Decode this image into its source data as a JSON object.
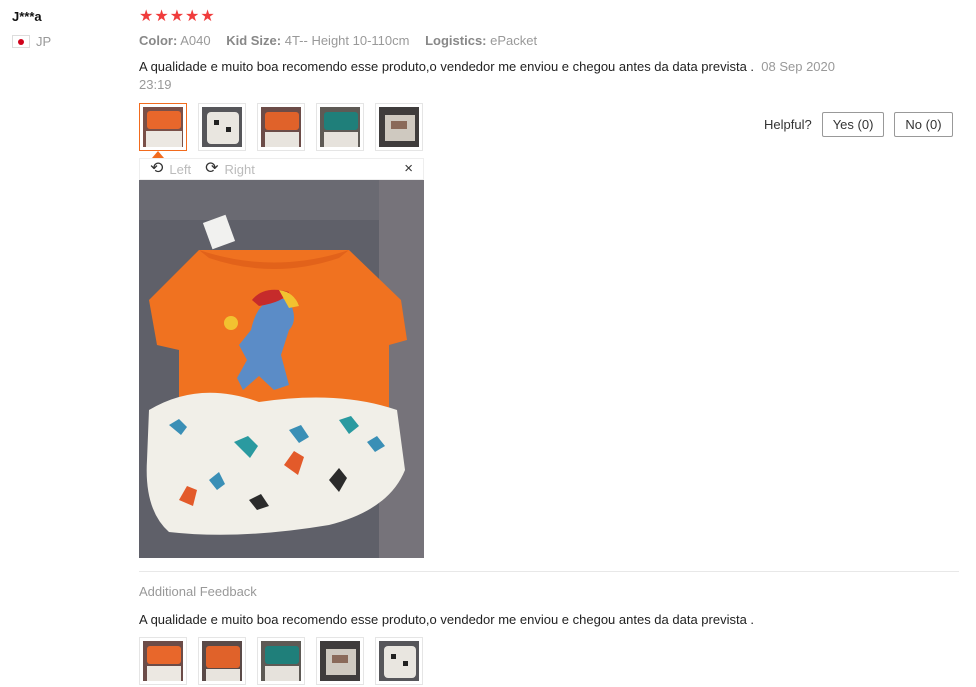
{
  "reviewer": {
    "name": "J***a",
    "country_code": "JP",
    "flag": "japan-flag"
  },
  "rating": {
    "stars": 5,
    "max": 5,
    "star_char": "★",
    "color": "#f03c3c"
  },
  "attributes": [
    {
      "key": "Color:",
      "value": "A040"
    },
    {
      "key": "Kid Size:",
      "value": "4T-- Height 10-110cm"
    },
    {
      "key": "Logistics:",
      "value": "ePacket"
    }
  ],
  "review": {
    "text": "A qualidade e muito boa recomendo esse produto,o vendedor me enviou e chegou antes da data prevista .",
    "date": "08 Sep 2020 23:19"
  },
  "helpful": {
    "label": "Helpful?",
    "yes": "Yes (0)",
    "no": "No (0)"
  },
  "viewer": {
    "rotate_left": "Left",
    "rotate_right": "Right",
    "close": "×"
  },
  "thumbnails": [
    "orange-top-thumb",
    "white-pants-thumb",
    "orange-top-thumb",
    "teal-top-thumb",
    "folded-set-thumb"
  ],
  "additional": {
    "heading": "Additional Feedback",
    "text": "A qualidade e muito boa recomendo esse produto,o vendedor me enviou e chegou antes da data prevista .",
    "thumbnails": [
      "orange-top-thumb",
      "orange-top-thumb",
      "teal-top-thumb",
      "folded-set-thumb",
      "white-pants-thumb"
    ]
  },
  "colors": {
    "accent": "#f26b1d",
    "muted": "#999999"
  }
}
